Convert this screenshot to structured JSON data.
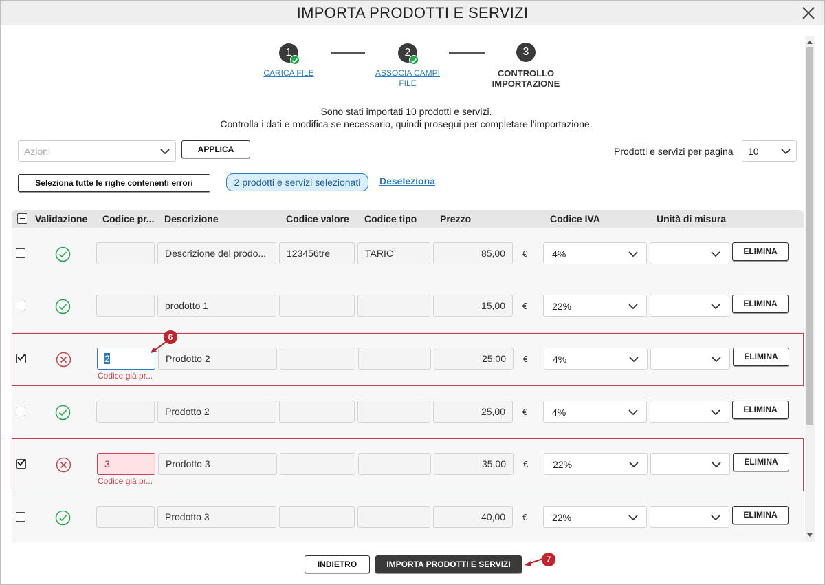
{
  "dialog": {
    "title": "IMPORTA PRODOTTI E SERVIZI"
  },
  "steps": [
    {
      "number": "1",
      "label": "CARICA FILE",
      "done": true
    },
    {
      "number": "2",
      "label_line1": "ASSOCIA CAMPI",
      "label_line2": "FILE",
      "done": true
    },
    {
      "number": "3",
      "label_line1": "CONTROLLO",
      "label_line2": "IMPORTAZIONE",
      "done": false
    }
  ],
  "info": {
    "line1": "Sono stati importati 10 prodotti e servizi.",
    "line2": "Controlla i dati e modifica se necessario, quindi prosegui per completare l'importazione."
  },
  "toolbar": {
    "actions_placeholder": "Azioni",
    "apply_label": "APPLICA",
    "per_page_label": "Prodotti e servizi per pagina",
    "per_page_value": "10",
    "select_error_rows_label": "Seleziona tutte le righe contenenti errori",
    "selected_badge": "2 prodotti e servizi selezionati",
    "deselect_label": "Deseleziona"
  },
  "table": {
    "columns": [
      "Validazione",
      "Codice pr...",
      "Descrizione",
      "Codice valore",
      "Codice tipo",
      "Prezzo",
      "Codice IVA",
      "Unità di misura"
    ],
    "delete_label": "ELIMINA",
    "currency": "€",
    "rows": [
      {
        "checked": false,
        "valid": true,
        "code": "",
        "description": "Descrizione del prodo...",
        "value_code": "123456tre",
        "type_code": "TARIC",
        "price": "85,00",
        "vat": "4%",
        "unit": ""
      },
      {
        "checked": false,
        "valid": true,
        "code": "",
        "description": "prodotto 1",
        "value_code": "",
        "type_code": "",
        "price": "15,00",
        "vat": "22%",
        "unit": ""
      },
      {
        "checked": true,
        "valid": false,
        "code": "2",
        "description": "Prodotto 2",
        "value_code": "",
        "type_code": "",
        "price": "25,00",
        "vat": "4%",
        "unit": "",
        "error": "Codice già pr..."
      },
      {
        "checked": false,
        "valid": true,
        "code": "",
        "description": "Prodotto 2",
        "value_code": "",
        "type_code": "",
        "price": "25,00",
        "vat": "4%",
        "unit": ""
      },
      {
        "checked": true,
        "valid": false,
        "code": "3",
        "description": "Prodotto 3",
        "value_code": "",
        "type_code": "",
        "price": "35,00",
        "vat": "22%",
        "unit": "",
        "error": "Codice già pr..."
      },
      {
        "checked": false,
        "valid": true,
        "code": "",
        "description": "Prodotto 3",
        "value_code": "",
        "type_code": "",
        "price": "40,00",
        "vat": "22%",
        "unit": ""
      }
    ]
  },
  "footer": {
    "back_label": "INDIETRO",
    "import_label": "IMPORTA PRODOTTI E SERVIZI"
  },
  "markers": [
    "6",
    "7"
  ],
  "colors": {
    "link": "#2a7bbf",
    "valid": "#1ea84a",
    "error": "#c8434c",
    "dark_button": "#3a3a3a"
  }
}
